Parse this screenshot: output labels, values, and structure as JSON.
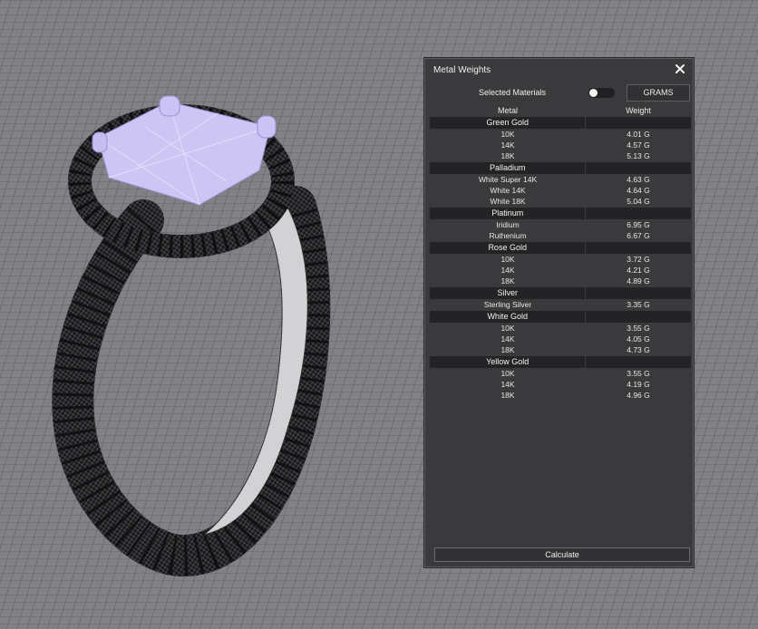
{
  "panel": {
    "title": "Metal Weights",
    "selected_materials_label": "Selected Materials",
    "toggle_on": false,
    "units_button": "GRAMS",
    "columns": {
      "metal": "Metal",
      "weight": "Weight"
    },
    "groups": [
      {
        "name": "Green Gold",
        "rows": [
          {
            "metal": "10K",
            "weight": "4.01 G"
          },
          {
            "metal": "14K",
            "weight": "4.57 G"
          },
          {
            "metal": "18K",
            "weight": "5.13 G"
          }
        ]
      },
      {
        "name": "Palladium",
        "rows": [
          {
            "metal": "White Super 14K",
            "weight": "4.63 G"
          },
          {
            "metal": "White 14K",
            "weight": "4.64 G"
          },
          {
            "metal": "White 18K",
            "weight": "5.04 G"
          }
        ]
      },
      {
        "name": "Platinum",
        "rows": [
          {
            "metal": "Iridium",
            "weight": "6.95 G"
          },
          {
            "metal": "Ruthenium",
            "weight": "6.67 G"
          }
        ]
      },
      {
        "name": "Rose Gold",
        "rows": [
          {
            "metal": "10K",
            "weight": "3.72 G"
          },
          {
            "metal": "14K",
            "weight": "4.21 G"
          },
          {
            "metal": "18K",
            "weight": "4.89 G"
          }
        ]
      },
      {
        "name": "Silver",
        "rows": [
          {
            "metal": "Sterling Silver",
            "weight": "3.35 G"
          }
        ]
      },
      {
        "name": "White Gold",
        "rows": [
          {
            "metal": "10K",
            "weight": "3.55 G"
          },
          {
            "metal": "14K",
            "weight": "4.05 G"
          },
          {
            "metal": "18K",
            "weight": "4.73 G"
          }
        ]
      },
      {
        "name": "Yellow Gold",
        "rows": [
          {
            "metal": "10K",
            "weight": "3.55 G"
          },
          {
            "metal": "14K",
            "weight": "4.19 G"
          },
          {
            "metal": "18K",
            "weight": "4.96 G"
          }
        ]
      }
    ],
    "calculate_button": "Calculate"
  },
  "icons": {
    "close": "close-icon"
  },
  "colors": {
    "panel_bg": "#3a3a3c",
    "group_header_bg": "#232325",
    "viewport_bg": "#7f8083",
    "grid_line": "#5c5d60",
    "gem": "#c9c2f2"
  }
}
